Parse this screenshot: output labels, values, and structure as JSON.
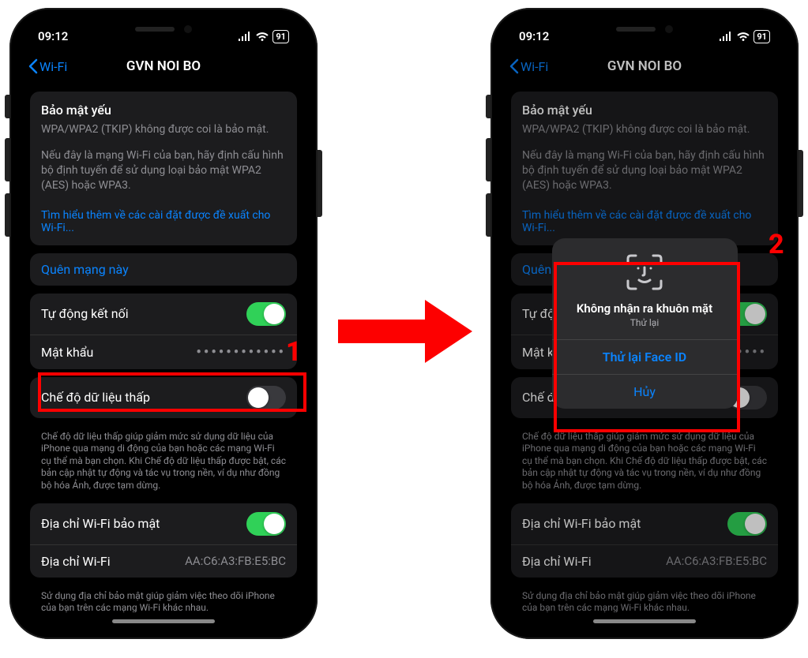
{
  "status": {
    "time": "09:12",
    "battery": "91"
  },
  "nav": {
    "back": "Wi-Fi",
    "title": "GVN NOI BO"
  },
  "security": {
    "title": "Bảo mật yếu",
    "line1": "WPA/WPA2 (TKIP) không được coi là bảo mật.",
    "line2": "Nếu đây là mạng Wi-Fi của bạn, hãy định cấu hình bộ định tuyến để sử dụng loại bảo mật WPA2 (AES) hoặc WPA3.",
    "learn_more": "Tìm hiểu thêm về các cài đặt được đề xuất cho Wi-Fi..."
  },
  "forget": {
    "label": "Quên mạng này"
  },
  "auto_join": {
    "label": "Tự động kết nối"
  },
  "password": {
    "label": "Mật khẩu",
    "value": "••••••••••••"
  },
  "low_data": {
    "label": "Chế độ dữ liệu thấp",
    "desc": "Chế độ dữ liệu thấp giúp giảm mức sử dụng dữ liệu của iPhone qua mạng di động của bạn hoặc các mạng Wi-Fi cụ thể mà bạn chọn. Khi Chế độ dữ liệu thấp được bật, các bản cập nhật tự động và tác vụ trong nền, ví dụ như đồng bộ hóa Ảnh, được tạm dừng."
  },
  "private_addr": {
    "label": "Địa chỉ Wi-Fi bảo mật",
    "addr_label": "Địa chỉ Wi-Fi",
    "addr_value": "AA:C6:A3:FB:E5:BC",
    "desc": "Sử dụng địa chỉ bảo mật giúp giảm việc theo dõi iPhone của bạn trên các mạng Wi-Fi khác nhau."
  },
  "dialog": {
    "title": "Không nhận ra khuôn mặt",
    "subtitle": "Thử lại",
    "retry": "Thử lại Face ID",
    "cancel": "Hủy"
  },
  "annotations": {
    "one": "1",
    "two": "2"
  }
}
